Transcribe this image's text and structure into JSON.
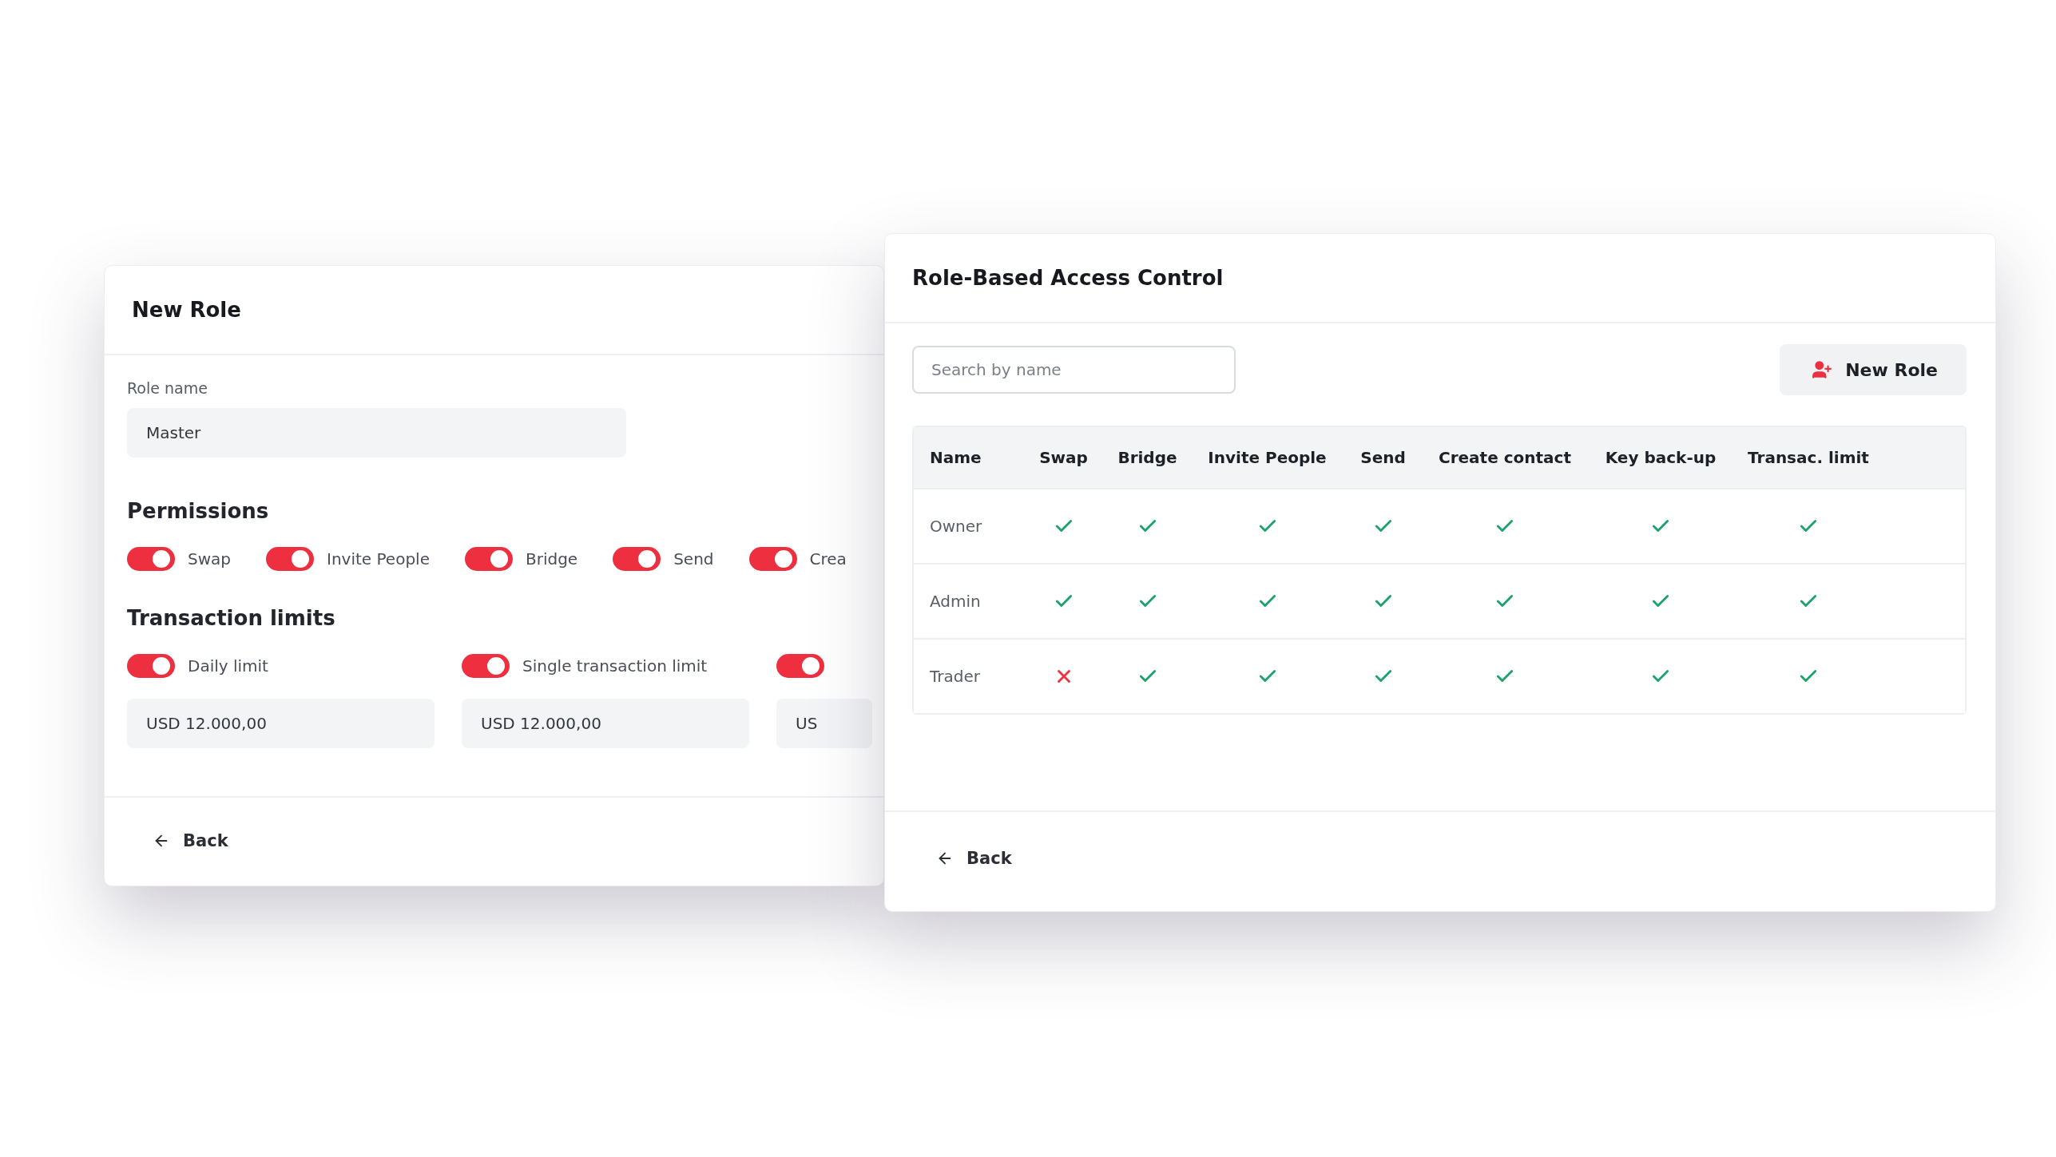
{
  "new_role_panel": {
    "title": "New Role",
    "role_name": {
      "label": "Role name",
      "value": "Master"
    },
    "permissions_title": "Permissions",
    "permissions": [
      {
        "label": "Swap",
        "on": true
      },
      {
        "label": "Invite People",
        "on": true
      },
      {
        "label": "Bridge",
        "on": true
      },
      {
        "label": "Send",
        "on": true
      },
      {
        "label": "Crea",
        "on": true
      }
    ],
    "limits_title": "Transaction limits",
    "limits": [
      {
        "label": "Daily limit",
        "on": true,
        "value": "USD 12.000,00"
      },
      {
        "label": "Single transaction limit",
        "on": true,
        "value": "USD 12.000,00"
      },
      {
        "on": true,
        "value": "US"
      }
    ],
    "back": "Back"
  },
  "access_panel": {
    "title": "Role-Based Access Control",
    "search": {
      "placeholder": "Search by name"
    },
    "new_role_button": "New Role",
    "table": {
      "columns": [
        "Name",
        "Swap",
        "Bridge",
        "Invite People",
        "Send",
        "Create contact",
        "Key back-up",
        "Transac. limit"
      ],
      "rows": [
        {
          "name": "Owner",
          "cells": [
            true,
            true,
            true,
            true,
            true,
            true,
            true
          ]
        },
        {
          "name": "Admin",
          "cells": [
            true,
            true,
            true,
            true,
            true,
            true,
            true
          ]
        },
        {
          "name": "Trader",
          "cells": [
            false,
            true,
            true,
            true,
            true,
            true,
            true
          ]
        }
      ]
    },
    "back": "Back"
  }
}
